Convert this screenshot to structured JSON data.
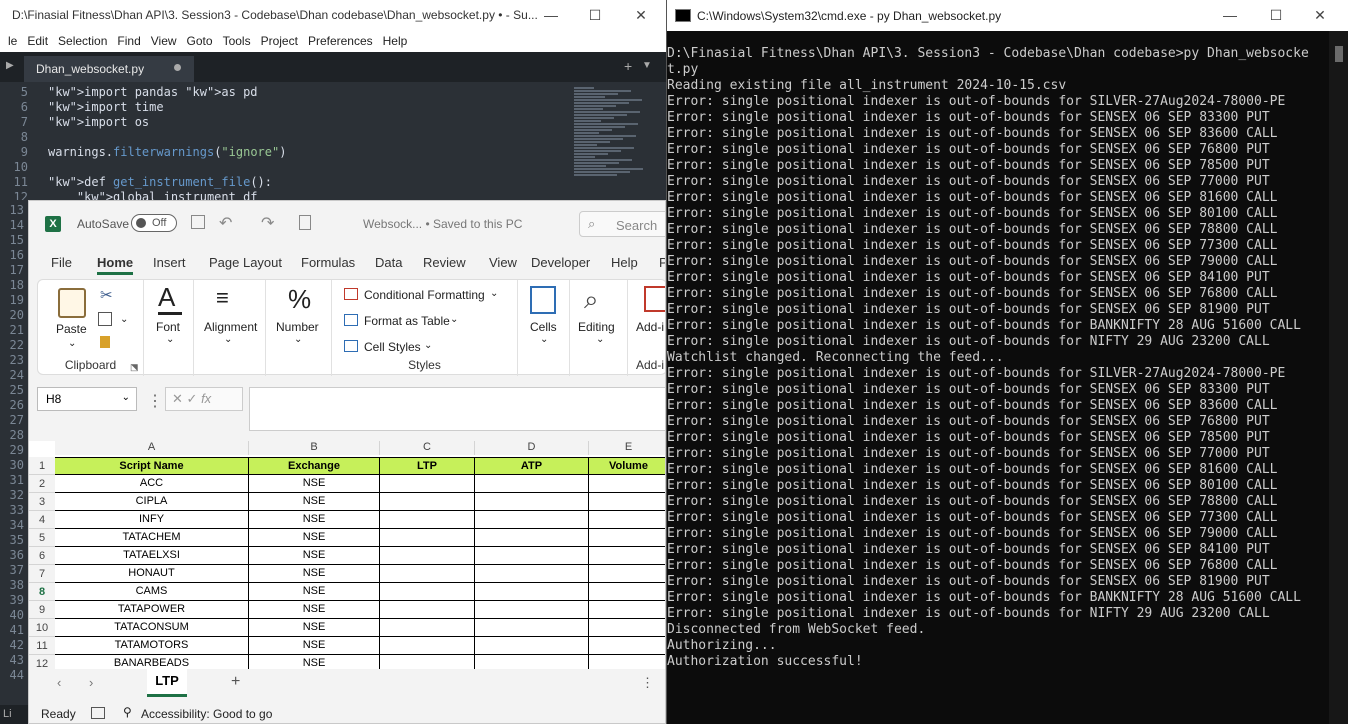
{
  "sublime": {
    "title": "D:\\Finasial Fitness\\Dhan API\\3. Session3 - Codebase\\Dhan codebase\\Dhan_websocket.py • - Su...",
    "menu": [
      "le",
      "Edit",
      "Selection",
      "Find",
      "View",
      "Goto",
      "Tools",
      "Project",
      "Preferences",
      "Help"
    ],
    "tab_label": "Dhan_websocket.py",
    "code_lines": [
      {
        "n": "5",
        "t": "import pandas as pd"
      },
      {
        "n": "6",
        "t": "import time"
      },
      {
        "n": "7",
        "t": "import os"
      },
      {
        "n": "8",
        "t": ""
      },
      {
        "n": "9",
        "t": "warnings.filterwarnings(\"ignore\")"
      },
      {
        "n": "10",
        "t": ""
      },
      {
        "n": "11",
        "t": "def get_instrument_file():"
      },
      {
        "n": "12",
        "t": "    global instrument_df"
      }
    ],
    "gutter_lines": [
      "13",
      "14",
      "15",
      "16",
      "17",
      "18",
      "19",
      "20",
      "21",
      "22",
      "23",
      "24",
      "25",
      "26",
      "27",
      "28",
      "29",
      "30",
      "31",
      "32",
      "33",
      "34",
      "35",
      "36",
      "37",
      "38",
      "39",
      "40",
      "41",
      "42",
      "43",
      "44"
    ],
    "status_text": "Li"
  },
  "excel": {
    "autosave_label": "AutoSave",
    "autosave_state": "Off",
    "doc_title": "Websock... • Saved to this PC",
    "search_placeholder": "Search",
    "ribbon_tabs": [
      "File",
      "Home",
      "Insert",
      "Page Layout",
      "Formulas",
      "Data",
      "Review",
      "View",
      "Developer",
      "Help",
      "P"
    ],
    "active_tab": "Home",
    "clipboard": {
      "paste": "Paste",
      "label": "Clipboard"
    },
    "font_label": "Font",
    "alignment_label": "Alignment",
    "number_label": "Number",
    "styles": {
      "conditional": "Conditional Formatting",
      "format_table": "Format as Table",
      "cell_styles": "Cell Styles",
      "label": "Styles"
    },
    "cells_label": "Cells",
    "editing_label": "Editing",
    "addins_label": "Add-i",
    "addins_group": "Add-i",
    "name_box": "H8",
    "fx": "fx",
    "columns": [
      "A",
      "B",
      "C",
      "D",
      "E"
    ],
    "header_row": [
      "Script Name",
      "Exchange",
      "LTP",
      "ATP",
      "Volume"
    ],
    "rows": [
      [
        "2",
        "ACC",
        "NSE"
      ],
      [
        "3",
        "CIPLA",
        "NSE"
      ],
      [
        "4",
        "INFY",
        "NSE"
      ],
      [
        "5",
        "TATACHEM",
        "NSE"
      ],
      [
        "6",
        "TATAELXSI",
        "NSE"
      ],
      [
        "7",
        "HONAUT",
        "NSE"
      ],
      [
        "8",
        "CAMS",
        "NSE"
      ],
      [
        "9",
        "TATAPOWER",
        "NSE"
      ],
      [
        "10",
        "TATACONSUM",
        "NSE"
      ],
      [
        "11",
        "TATAMOTORS",
        "NSE"
      ],
      [
        "12",
        "BANARBEADS",
        "NSE"
      ]
    ],
    "sheet_tab": "LTP",
    "status_ready": "Ready",
    "status_accessibility": "Accessibility: Good to go"
  },
  "cmd": {
    "title": "C:\\Windows\\System32\\cmd.exe - py  Dhan_websocket.py",
    "lines": [
      "D:\\Finasial Fitness\\Dhan API\\3. Session3 - Codebase\\Dhan codebase>py Dhan_websocke",
      "t.py",
      "Reading existing file all_instrument 2024-10-15.csv",
      "Error: single positional indexer is out-of-bounds for SILVER-27Aug2024-78000-PE",
      "Error: single positional indexer is out-of-bounds for SENSEX 06 SEP 83300 PUT",
      "Error: single positional indexer is out-of-bounds for SENSEX 06 SEP 83600 CALL",
      "Error: single positional indexer is out-of-bounds for SENSEX 06 SEP 76800 PUT",
      "Error: single positional indexer is out-of-bounds for SENSEX 06 SEP 78500 PUT",
      "Error: single positional indexer is out-of-bounds for SENSEX 06 SEP 77000 PUT",
      "Error: single positional indexer is out-of-bounds for SENSEX 06 SEP 81600 CALL",
      "Error: single positional indexer is out-of-bounds for SENSEX 06 SEP 80100 CALL",
      "Error: single positional indexer is out-of-bounds for SENSEX 06 SEP 78800 CALL",
      "Error: single positional indexer is out-of-bounds for SENSEX 06 SEP 77300 CALL",
      "Error: single positional indexer is out-of-bounds for SENSEX 06 SEP 79000 CALL",
      "Error: single positional indexer is out-of-bounds for SENSEX 06 SEP 84100 PUT",
      "Error: single positional indexer is out-of-bounds for SENSEX 06 SEP 76800 CALL",
      "Error: single positional indexer is out-of-bounds for SENSEX 06 SEP 81900 PUT",
      "Error: single positional indexer is out-of-bounds for BANKNIFTY 28 AUG 51600 CALL",
      "Error: single positional indexer is out-of-bounds for NIFTY 29 AUG 23200 CALL",
      "Watchlist changed. Reconnecting the feed...",
      "Error: single positional indexer is out-of-bounds for SILVER-27Aug2024-78000-PE",
      "Error: single positional indexer is out-of-bounds for SENSEX 06 SEP 83300 PUT",
      "Error: single positional indexer is out-of-bounds for SENSEX 06 SEP 83600 CALL",
      "Error: single positional indexer is out-of-bounds for SENSEX 06 SEP 76800 PUT",
      "Error: single positional indexer is out-of-bounds for SENSEX 06 SEP 78500 PUT",
      "Error: single positional indexer is out-of-bounds for SENSEX 06 SEP 77000 PUT",
      "Error: single positional indexer is out-of-bounds for SENSEX 06 SEP 81600 CALL",
      "Error: single positional indexer is out-of-bounds for SENSEX 06 SEP 80100 CALL",
      "Error: single positional indexer is out-of-bounds for SENSEX 06 SEP 78800 CALL",
      "Error: single positional indexer is out-of-bounds for SENSEX 06 SEP 77300 CALL",
      "Error: single positional indexer is out-of-bounds for SENSEX 06 SEP 79000 CALL",
      "Error: single positional indexer is out-of-bounds for SENSEX 06 SEP 84100 PUT",
      "Error: single positional indexer is out-of-bounds for SENSEX 06 SEP 76800 CALL",
      "Error: single positional indexer is out-of-bounds for SENSEX 06 SEP 81900 PUT",
      "Error: single positional indexer is out-of-bounds for BANKNIFTY 28 AUG 51600 CALL",
      "Error: single positional indexer is out-of-bounds for NIFTY 29 AUG 23200 CALL",
      "Disconnected from WebSocket feed.",
      "Authorizing...",
      "Authorization successful!"
    ]
  }
}
